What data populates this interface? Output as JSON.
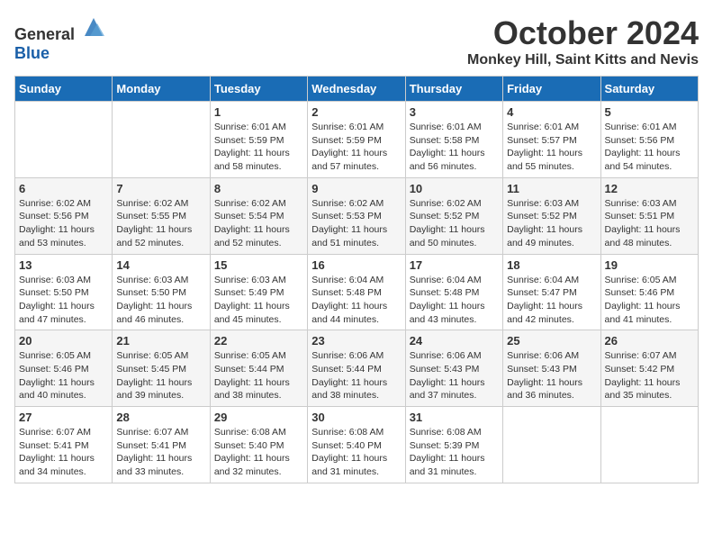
{
  "header": {
    "logo_general": "General",
    "logo_blue": "Blue",
    "month": "October 2024",
    "location": "Monkey Hill, Saint Kitts and Nevis"
  },
  "weekdays": [
    "Sunday",
    "Monday",
    "Tuesday",
    "Wednesday",
    "Thursday",
    "Friday",
    "Saturday"
  ],
  "weeks": [
    [
      {
        "day": "",
        "sunrise": "",
        "sunset": "",
        "daylight": ""
      },
      {
        "day": "",
        "sunrise": "",
        "sunset": "",
        "daylight": ""
      },
      {
        "day": "1",
        "sunrise": "Sunrise: 6:01 AM",
        "sunset": "Sunset: 5:59 PM",
        "daylight": "Daylight: 11 hours and 58 minutes."
      },
      {
        "day": "2",
        "sunrise": "Sunrise: 6:01 AM",
        "sunset": "Sunset: 5:59 PM",
        "daylight": "Daylight: 11 hours and 57 minutes."
      },
      {
        "day": "3",
        "sunrise": "Sunrise: 6:01 AM",
        "sunset": "Sunset: 5:58 PM",
        "daylight": "Daylight: 11 hours and 56 minutes."
      },
      {
        "day": "4",
        "sunrise": "Sunrise: 6:01 AM",
        "sunset": "Sunset: 5:57 PM",
        "daylight": "Daylight: 11 hours and 55 minutes."
      },
      {
        "day": "5",
        "sunrise": "Sunrise: 6:01 AM",
        "sunset": "Sunset: 5:56 PM",
        "daylight": "Daylight: 11 hours and 54 minutes."
      }
    ],
    [
      {
        "day": "6",
        "sunrise": "Sunrise: 6:02 AM",
        "sunset": "Sunset: 5:56 PM",
        "daylight": "Daylight: 11 hours and 53 minutes."
      },
      {
        "day": "7",
        "sunrise": "Sunrise: 6:02 AM",
        "sunset": "Sunset: 5:55 PM",
        "daylight": "Daylight: 11 hours and 52 minutes."
      },
      {
        "day": "8",
        "sunrise": "Sunrise: 6:02 AM",
        "sunset": "Sunset: 5:54 PM",
        "daylight": "Daylight: 11 hours and 52 minutes."
      },
      {
        "day": "9",
        "sunrise": "Sunrise: 6:02 AM",
        "sunset": "Sunset: 5:53 PM",
        "daylight": "Daylight: 11 hours and 51 minutes."
      },
      {
        "day": "10",
        "sunrise": "Sunrise: 6:02 AM",
        "sunset": "Sunset: 5:52 PM",
        "daylight": "Daylight: 11 hours and 50 minutes."
      },
      {
        "day": "11",
        "sunrise": "Sunrise: 6:03 AM",
        "sunset": "Sunset: 5:52 PM",
        "daylight": "Daylight: 11 hours and 49 minutes."
      },
      {
        "day": "12",
        "sunrise": "Sunrise: 6:03 AM",
        "sunset": "Sunset: 5:51 PM",
        "daylight": "Daylight: 11 hours and 48 minutes."
      }
    ],
    [
      {
        "day": "13",
        "sunrise": "Sunrise: 6:03 AM",
        "sunset": "Sunset: 5:50 PM",
        "daylight": "Daylight: 11 hours and 47 minutes."
      },
      {
        "day": "14",
        "sunrise": "Sunrise: 6:03 AM",
        "sunset": "Sunset: 5:50 PM",
        "daylight": "Daylight: 11 hours and 46 minutes."
      },
      {
        "day": "15",
        "sunrise": "Sunrise: 6:03 AM",
        "sunset": "Sunset: 5:49 PM",
        "daylight": "Daylight: 11 hours and 45 minutes."
      },
      {
        "day": "16",
        "sunrise": "Sunrise: 6:04 AM",
        "sunset": "Sunset: 5:48 PM",
        "daylight": "Daylight: 11 hours and 44 minutes."
      },
      {
        "day": "17",
        "sunrise": "Sunrise: 6:04 AM",
        "sunset": "Sunset: 5:48 PM",
        "daylight": "Daylight: 11 hours and 43 minutes."
      },
      {
        "day": "18",
        "sunrise": "Sunrise: 6:04 AM",
        "sunset": "Sunset: 5:47 PM",
        "daylight": "Daylight: 11 hours and 42 minutes."
      },
      {
        "day": "19",
        "sunrise": "Sunrise: 6:05 AM",
        "sunset": "Sunset: 5:46 PM",
        "daylight": "Daylight: 11 hours and 41 minutes."
      }
    ],
    [
      {
        "day": "20",
        "sunrise": "Sunrise: 6:05 AM",
        "sunset": "Sunset: 5:46 PM",
        "daylight": "Daylight: 11 hours and 40 minutes."
      },
      {
        "day": "21",
        "sunrise": "Sunrise: 6:05 AM",
        "sunset": "Sunset: 5:45 PM",
        "daylight": "Daylight: 11 hours and 39 minutes."
      },
      {
        "day": "22",
        "sunrise": "Sunrise: 6:05 AM",
        "sunset": "Sunset: 5:44 PM",
        "daylight": "Daylight: 11 hours and 38 minutes."
      },
      {
        "day": "23",
        "sunrise": "Sunrise: 6:06 AM",
        "sunset": "Sunset: 5:44 PM",
        "daylight": "Daylight: 11 hours and 38 minutes."
      },
      {
        "day": "24",
        "sunrise": "Sunrise: 6:06 AM",
        "sunset": "Sunset: 5:43 PM",
        "daylight": "Daylight: 11 hours and 37 minutes."
      },
      {
        "day": "25",
        "sunrise": "Sunrise: 6:06 AM",
        "sunset": "Sunset: 5:43 PM",
        "daylight": "Daylight: 11 hours and 36 minutes."
      },
      {
        "day": "26",
        "sunrise": "Sunrise: 6:07 AM",
        "sunset": "Sunset: 5:42 PM",
        "daylight": "Daylight: 11 hours and 35 minutes."
      }
    ],
    [
      {
        "day": "27",
        "sunrise": "Sunrise: 6:07 AM",
        "sunset": "Sunset: 5:41 PM",
        "daylight": "Daylight: 11 hours and 34 minutes."
      },
      {
        "day": "28",
        "sunrise": "Sunrise: 6:07 AM",
        "sunset": "Sunset: 5:41 PM",
        "daylight": "Daylight: 11 hours and 33 minutes."
      },
      {
        "day": "29",
        "sunrise": "Sunrise: 6:08 AM",
        "sunset": "Sunset: 5:40 PM",
        "daylight": "Daylight: 11 hours and 32 minutes."
      },
      {
        "day": "30",
        "sunrise": "Sunrise: 6:08 AM",
        "sunset": "Sunset: 5:40 PM",
        "daylight": "Daylight: 11 hours and 31 minutes."
      },
      {
        "day": "31",
        "sunrise": "Sunrise: 6:08 AM",
        "sunset": "Sunset: 5:39 PM",
        "daylight": "Daylight: 11 hours and 31 minutes."
      },
      {
        "day": "",
        "sunrise": "",
        "sunset": "",
        "daylight": ""
      },
      {
        "day": "",
        "sunrise": "",
        "sunset": "",
        "daylight": ""
      }
    ]
  ]
}
